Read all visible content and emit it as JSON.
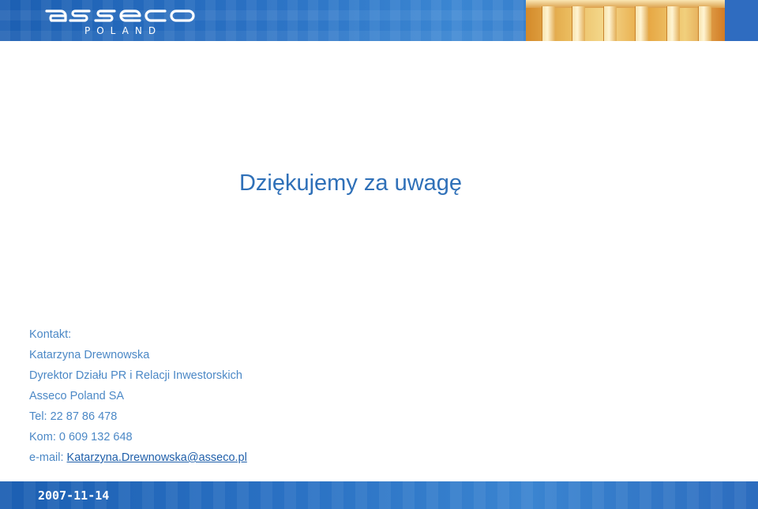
{
  "header": {
    "logo_text": "asseco",
    "logo_sub": "POLAND"
  },
  "title": "Dziękujemy za uwagę",
  "contact": {
    "heading": "Kontakt:",
    "name": "Katarzyna Drewnowska",
    "position": "Dyrektor Działu PR i Relacji Inwestorskich",
    "company": "Asseco Poland SA",
    "tel": "Tel: 22 87 86 478",
    "mobile": "Kom: 0 609 132 648",
    "email_label": "e-mail: ",
    "email": "Katarzyna.Drewnowska@asseco.pl"
  },
  "footer": {
    "date": "2007-11-14"
  },
  "colors": {
    "brand_blue": "#2b72c4",
    "title_blue": "#2f70b8",
    "text_blue": "#4b88c6"
  }
}
